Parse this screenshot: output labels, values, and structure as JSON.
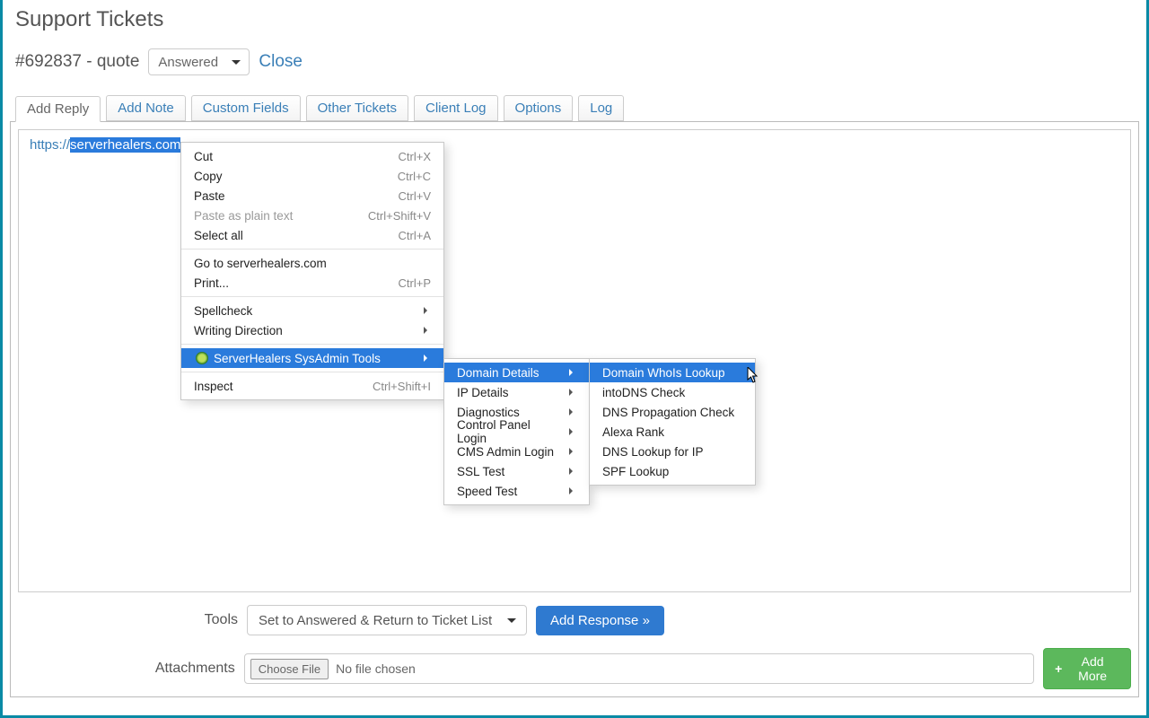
{
  "page": {
    "title": "Support Tickets"
  },
  "ticket": {
    "id_label": "#692837 - quote",
    "status": "Answered",
    "close": "Close"
  },
  "tabs": {
    "add_reply": "Add Reply",
    "add_note": "Add Note",
    "custom_fields": "Custom Fields",
    "other_tickets": "Other Tickets",
    "client_log": "Client Log",
    "options": "Options",
    "log": "Log"
  },
  "editor": {
    "prefix": "https://",
    "selected": "serverhealers.com"
  },
  "tools": {
    "label": "Tools",
    "select_value": "Set to Answered & Return to Ticket List",
    "submit": "Add Response »"
  },
  "attach": {
    "label": "Attachments",
    "choose": "Choose File",
    "none": "No file chosen",
    "add_more": "Add More"
  },
  "ctx1": {
    "cut": {
      "l": "Cut",
      "s": "Ctrl+X"
    },
    "copy": {
      "l": "Copy",
      "s": "Ctrl+C"
    },
    "paste": {
      "l": "Paste",
      "s": "Ctrl+V"
    },
    "paste_plain": {
      "l": "Paste as plain text",
      "s": "Ctrl+Shift+V"
    },
    "select_all": {
      "l": "Select all",
      "s": "Ctrl+A"
    },
    "goto": {
      "l": "Go to serverhealers.com",
      "s": ""
    },
    "print": {
      "l": "Print...",
      "s": "Ctrl+P"
    },
    "spell": {
      "l": "Spellcheck",
      "s": ""
    },
    "writing": {
      "l": "Writing Direction",
      "s": ""
    },
    "ext": {
      "l": "ServerHealers SysAdmin Tools",
      "s": ""
    },
    "inspect": {
      "l": "Inspect",
      "s": "Ctrl+Shift+I"
    }
  },
  "ctx2": {
    "domain": "Domain Details",
    "ip": "IP Details",
    "diag": "Diagnostics",
    "cpanel": "Control Panel Login",
    "cms": "CMS Admin Login",
    "ssl": "SSL Test",
    "speed": "Speed Test"
  },
  "ctx3": {
    "whois": "Domain WhoIs Lookup",
    "intodns": "intoDNS Check",
    "prop": "DNS Propagation Check",
    "alexa": "Alexa Rank",
    "dnsip": "DNS Lookup for IP",
    "spf": "SPF Lookup"
  }
}
